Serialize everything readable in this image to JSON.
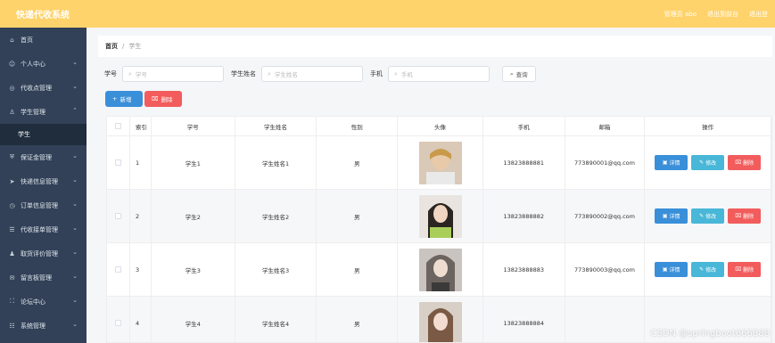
{
  "app": {
    "title": "快递代收系统"
  },
  "topbar": {
    "user_label": "管理员 abo",
    "back_label": "退出到前台",
    "logout_label": "退出登"
  },
  "sidebar": {
    "items": [
      {
        "label": "首页",
        "icon": "home-icon"
      },
      {
        "label": "个人中心",
        "icon": "user-icon"
      },
      {
        "label": "代收点管理",
        "icon": "location-icon"
      },
      {
        "label": "学生管理",
        "icon": "student-icon"
      },
      {
        "label": "学生",
        "icon": ""
      },
      {
        "label": "保证金管理",
        "icon": "shield-icon"
      },
      {
        "label": "快递信息管理",
        "icon": "send-icon"
      },
      {
        "label": "订单信息管理",
        "icon": "clock-icon"
      },
      {
        "label": "代收接单管理",
        "icon": "list-icon"
      },
      {
        "label": "取货评价管理",
        "icon": "rating-icon"
      },
      {
        "label": "留言板管理",
        "icon": "message-icon"
      },
      {
        "label": "论坛中心",
        "icon": "forum-icon"
      },
      {
        "label": "系统管理",
        "icon": "settings-icon"
      }
    ]
  },
  "breadcrumb": {
    "home": "首页",
    "separator": "/",
    "current": "学生"
  },
  "filters": {
    "student_id_label": "学号",
    "student_id_placeholder": "学号",
    "student_name_label": "学生姓名",
    "student_name_placeholder": "学生姓名",
    "phone_label": "手机",
    "phone_placeholder": "手机",
    "query_label": "查询"
  },
  "actions": {
    "add_label": "新增",
    "delete_label": "删除"
  },
  "table": {
    "headers": [
      "",
      "索引",
      "学号",
      "学生姓名",
      "性别",
      "头像",
      "手机",
      "邮箱",
      "操作"
    ],
    "rows": [
      {
        "index": "1",
        "student_id": "学生1",
        "name": "学生姓名1",
        "gender": "男",
        "phone": "13823888881",
        "email": "773890001@qq.com"
      },
      {
        "index": "2",
        "student_id": "学生2",
        "name": "学生姓名2",
        "gender": "男",
        "phone": "13823888882",
        "email": "773890002@qq.com"
      },
      {
        "index": "3",
        "student_id": "学生3",
        "name": "学生姓名3",
        "gender": "男",
        "phone": "13823888883",
        "email": "773890003@qq.com"
      },
      {
        "index": "4",
        "student_id": "学生4",
        "name": "学生姓名4",
        "gender": "男",
        "phone": "13823888884",
        "email": ""
      }
    ],
    "op_detail": "详情",
    "op_edit": "修改",
    "op_delete": "删除"
  },
  "watermark": "CSDN @springboot666888",
  "colors": {
    "topbar": "#ffd36b",
    "sidebar": "#324157",
    "primary": "#3a8fd9",
    "danger": "#f25c5c",
    "info": "#48b7d8"
  }
}
